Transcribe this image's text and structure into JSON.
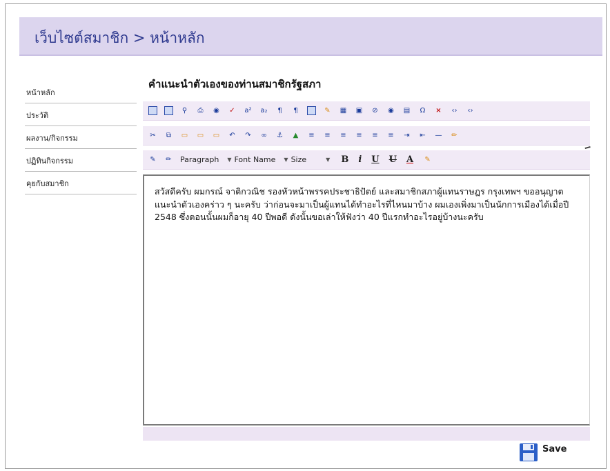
{
  "header": {
    "title": "เว็บไซต์สมาชิก > หน้าหลัก"
  },
  "sidebar": {
    "items": [
      {
        "label": "หน้าหลัก"
      },
      {
        "label": "ประวัติ"
      },
      {
        "label": "ผลงาน/กิจกรรม"
      },
      {
        "label": "ปฏิทินกิจกรรม"
      },
      {
        "label": "คุยกับสมาชิก"
      }
    ]
  },
  "main": {
    "section_title": "คำแนะนำตัวเองของท่านสมาชิกรัฐสภา",
    "editor": {
      "block_format": "Paragraph",
      "font_name": "Font Name",
      "font_size": "Size",
      "content": "สวัสดีครับ ผมกรณ์ จาติกวณิช รองหัวหน้าพรรคประชาธิปัตย์ และสมาชิกสภาผู้แทนราษฎร กรุงเทพฯ ขออนุญาตแนะนำตัวเองคร่าว ๆ นะครับ ว่าก่อนจะมาเป็นผู้แทนได้ทำอะไรที่ไหนมาบ้าง ผมเองเพิ่งมาเป็นนักการเมืองได้เมื่อปี 2548 ซึ่งตอนนั้นผมก็อายุ 40 ปีพอดี ดังนั้นขอเล่าให้ฟังว่า 40 ปีแรกทำอะไรอยู่บ้างนะครับ"
    },
    "save_label": "Save"
  }
}
